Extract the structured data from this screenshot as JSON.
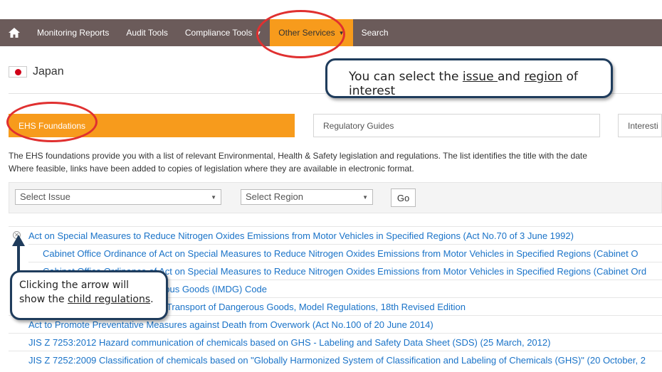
{
  "nav": {
    "home_icon": "home-icon",
    "items": [
      {
        "label": "Monitoring Reports"
      },
      {
        "label": "Audit Tools"
      },
      {
        "label": "Compliance Tools",
        "has_caret": true
      },
      {
        "label": "Other Services",
        "has_caret": true,
        "active": true
      },
      {
        "label": "Search"
      }
    ]
  },
  "country": {
    "name": "Japan",
    "flag_icon": "japan-flag-icon"
  },
  "tabs": [
    {
      "label": "EHS Foundations",
      "active": true
    },
    {
      "label": "Regulatory Guides"
    },
    {
      "label": "Interesti"
    }
  ],
  "intro": {
    "line1": "The EHS foundations provide you with a list of relevant Environmental, Health & Safety legislation and regulations. The list identifies the title with the date",
    "line2": "Where feasible, links have been added to copies of legislation where they are available in electronic format."
  },
  "filters": {
    "issue_label": "Select Issue",
    "region_label": "Select Region",
    "go_label": "Go"
  },
  "regulations": {
    "r0": "Act on Special Measures to Reduce Nitrogen Oxides Emissions from Motor Vehicles in Specified Regions (Act No.70 of 3 June 1992)",
    "r1": "Cabinet Office Ordinance of Act on Special Measures to Reduce Nitrogen Oxides Emissions from Motor Vehicles in Specified Regions (Cabinet O",
    "r2": "Cabinet Office Ordinance of Act on Special Measures to Reduce Nitrogen Oxides Emissions from Motor Vehicles in Specified Regions (Cabinet Ord",
    "r3": "International Maritime Dangerous Goods (IMDG) Code",
    "r4": "UN Recommendations on the Transport of Dangerous Goods, Model Regulations, 18th Revised Edition",
    "r5": "Act to Promote Preventative Measures against Death from Overwork (Act No.100 of 20 June 2014)",
    "r6": "JIS Z 7253:2012 Hazard communication of chemicals based on GHS - Labeling and Safety Data Sheet (SDS) (25 March, 2012)",
    "r7": "JIS Z 7252:2009 Classification of chemicals based on \"Globally Harmonized System of Classification and Labeling of Chemicals (GHS)\" (20 October, 2"
  },
  "callouts": {
    "c1": {
      "pre": "You can select the ",
      "u1": "issue ",
      "mid": "and ",
      "u2": "region",
      "post": " of interest"
    },
    "c2": {
      "line1": "Clicking the arrow will",
      "pre2": "show the ",
      "u": "child regulations",
      "post2": "."
    }
  },
  "colors": {
    "navbar": "#6b5b5a",
    "accent": "#f79b1c",
    "link": "#1a73c8",
    "callout_border": "#1f3c5c",
    "highlight_ring": "#e03030"
  }
}
